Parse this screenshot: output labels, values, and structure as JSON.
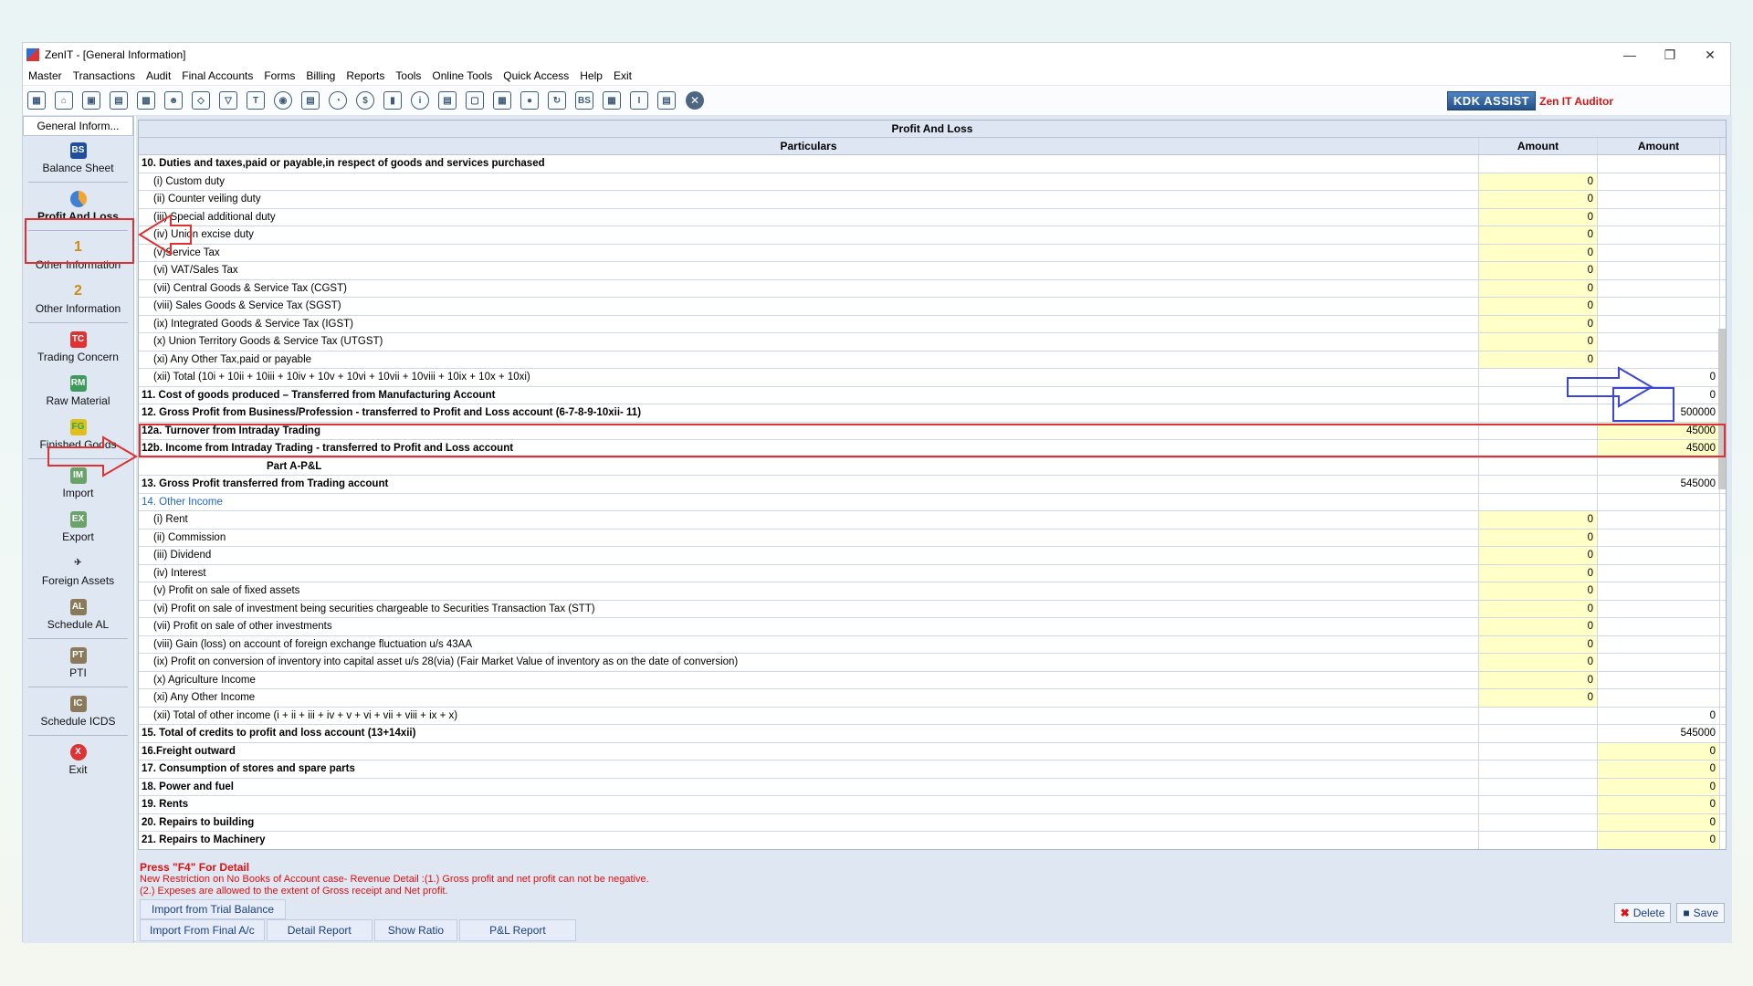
{
  "window": {
    "title": "ZenIT - [General Information]"
  },
  "menu": [
    "Master",
    "Transactions",
    "Audit",
    "Final Accounts",
    "Forms",
    "Billing",
    "Reports",
    "Tools",
    "Online Tools",
    "Quick Access",
    "Help",
    "Exit"
  ],
  "brand": {
    "kdk": "KDK ASSIST",
    "zen": "Zen IT Auditor"
  },
  "sidebar": {
    "header": "General Inform...",
    "items": [
      {
        "label": "Balance Sheet",
        "icon": "BS"
      },
      {
        "label": "Profit And Loss",
        "icon": "PL"
      },
      {
        "label": "Other Information",
        "icon": "1"
      },
      {
        "label": "Other Information",
        "icon": "2"
      },
      {
        "label": "Trading Concern",
        "icon": "TC"
      },
      {
        "label": "Raw Material",
        "icon": "RM"
      },
      {
        "label": "Finished Goods",
        "icon": "FG"
      },
      {
        "label": "Import",
        "icon": "IM"
      },
      {
        "label": "Export",
        "icon": "EX"
      },
      {
        "label": "Foreign Assets",
        "icon": "FA"
      },
      {
        "label": "Schedule AL",
        "icon": "AL"
      },
      {
        "label": "PTI",
        "icon": "PT"
      },
      {
        "label": "Schedule ICDS",
        "icon": "IC"
      },
      {
        "label": "Exit",
        "icon": "X"
      }
    ]
  },
  "grid": {
    "title": "Profit And Loss",
    "headers": {
      "particulars": "Particulars",
      "amount1": "Amount",
      "amount2": "Amount"
    },
    "rows": [
      {
        "text": "10. Duties and taxes,paid or payable,in respect of goods and services purchased",
        "a1": "",
        "a2": ""
      },
      {
        "text": "(i) Custom duty",
        "a1": "0",
        "a2": ""
      },
      {
        "text": "(ii) Counter veiling duty",
        "a1": "0",
        "a2": ""
      },
      {
        "text": "(iii) Special additional duty",
        "a1": "0",
        "a2": ""
      },
      {
        "text": "(iv) Union excise duty",
        "a1": "0",
        "a2": ""
      },
      {
        "text": "(v)Service Tax",
        "a1": "0",
        "a2": ""
      },
      {
        "text": "(vi) VAT/Sales Tax",
        "a1": "0",
        "a2": ""
      },
      {
        "text": "(vii) Central Goods & Service Tax (CGST)",
        "a1": "0",
        "a2": ""
      },
      {
        "text": "(viii) Sales Goods & Service Tax (SGST)",
        "a1": "0",
        "a2": ""
      },
      {
        "text": "(ix) Integrated Goods & Service Tax (IGST)",
        "a1": "0",
        "a2": ""
      },
      {
        "text": "(x) Union Territory Goods & Service Tax (UTGST)",
        "a1": "0",
        "a2": ""
      },
      {
        "text": "(xi) Any Other Tax,paid or payable",
        "a1": "0",
        "a2": ""
      },
      {
        "text": "(xii) Total (10i + 10ii + 10iii + 10iv + 10v + 10vi + 10vii + 10viii + 10ix + 10x + 10xi)",
        "a1": "",
        "a2": "0"
      },
      {
        "text": "11. Cost of goods produced – Transferred from Manufacturing Account",
        "a1": "",
        "a2": "0"
      },
      {
        "text": "12. Gross Profit from Business/Profession - transferred to Profit and Loss account (6-7-8-9-10xii- 11)",
        "a1": "",
        "a2": "500000"
      },
      {
        "text": "12a. Turnover from Intraday Trading",
        "a1": "",
        "a2": "45000"
      },
      {
        "text": "12b. Income from Intraday Trading - transferred to Profit and Loss account",
        "a1": "",
        "a2": "45000"
      },
      {
        "text": "Part A-P&L",
        "a1": "",
        "a2": ""
      },
      {
        "text": "13. Gross Profit transferred from Trading account",
        "a1": "",
        "a2": "545000"
      },
      {
        "text": "14. Other Income",
        "a1": "",
        "a2": ""
      },
      {
        "text": "(i) Rent",
        "a1": "0",
        "a2": ""
      },
      {
        "text": "(ii) Commission",
        "a1": "0",
        "a2": ""
      },
      {
        "text": "(iii) Dividend",
        "a1": "0",
        "a2": ""
      },
      {
        "text": "(iv) Interest",
        "a1": "0",
        "a2": ""
      },
      {
        "text": "(v) Profit on sale of fixed assets",
        "a1": "0",
        "a2": ""
      },
      {
        "text": "(vi) Profit on sale of investment being securities chargeable to Securities Transaction Tax (STT)",
        "a1": "0",
        "a2": ""
      },
      {
        "text": "(vii) Profit on sale of other investments",
        "a1": "0",
        "a2": ""
      },
      {
        "text": "(viii) Gain (loss) on account of foreign exchange fluctuation u/s 43AA",
        "a1": "0",
        "a2": ""
      },
      {
        "text": "(ix) Profit on conversion of inventory into capital asset u/s 28(via) (Fair Market Value of inventory as on the date of conversion)",
        "a1": "0",
        "a2": ""
      },
      {
        "text": "(x) Agriculture Income",
        "a1": "0",
        "a2": ""
      },
      {
        "text": "(xi) Any Other Income",
        "a1": "0",
        "a2": ""
      },
      {
        "text": "(xii) Total of other income (i + ii + iii + iv + v + vi + vii + viii + ix + x)",
        "a1": "",
        "a2": "0"
      },
      {
        "text": "15. Total of credits to profit and loss account (13+14xii)",
        "a1": "",
        "a2": "545000"
      },
      {
        "text": "16.Freight outward",
        "a1": "",
        "a2": "0"
      },
      {
        "text": "17. Consumption of stores and spare parts",
        "a1": "",
        "a2": "0"
      },
      {
        "text": "18. Power and fuel",
        "a1": "",
        "a2": "0"
      },
      {
        "text": "19. Rents",
        "a1": "",
        "a2": "0"
      },
      {
        "text": "20. Repairs to building",
        "a1": "",
        "a2": "0"
      },
      {
        "text": "21. Repairs to Machinery",
        "a1": "",
        "a2": "0"
      }
    ]
  },
  "notes": {
    "main": "Press \"F4\" For Detail",
    "line1": "New  Restriction on No Books of Account case- Revenue Detail :(1.) Gross profit and net profit can not be negative.",
    "line2": "(2.) Expeses are allowed to the extent of Gross receipt and Net profit."
  },
  "buttons": {
    "import_trial": "Import from Trial Balance",
    "import_final": "Import From Final A/c",
    "detail_report": "Detail Report",
    "show_ratio": "Show Ratio",
    "pl_report": "P&L Report",
    "delete": "Delete",
    "save": "Save"
  }
}
